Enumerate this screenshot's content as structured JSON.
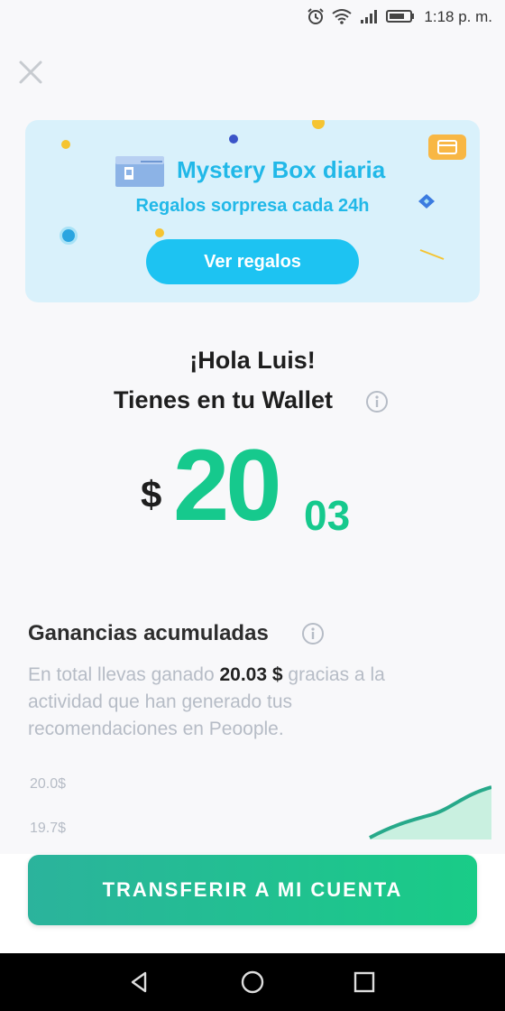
{
  "status_bar": {
    "time": "1:18 p. m.",
    "icons": [
      "alarm-icon",
      "wifi-icon",
      "signal-icon",
      "battery-icon"
    ]
  },
  "banner": {
    "title": "Mystery Box diaria",
    "subtitle": "Regalos sorpresa cada 24h",
    "button_label": "Ver regalos"
  },
  "wallet": {
    "greeting": "¡Hola Luis!",
    "label": "Tienes en tu Wallet",
    "currency": "$",
    "amount_integer": "20",
    "amount_decimal": "03"
  },
  "earnings": {
    "title": "Ganancias acumuladas",
    "text_before": "En total llevas ganado ",
    "amount": "20.03 $",
    "text_after": " gracias a la actividad que han generado tus recomendaciones en Peoople."
  },
  "chart_labels": [
    "20.0$",
    "19.7$"
  ],
  "actions": {
    "transfer_label": "TRANSFERIR A MI CUENTA"
  },
  "nav": [
    "back-icon",
    "home-icon",
    "recents-icon"
  ],
  "colors": {
    "accent_green": "#16c98d",
    "banner_blue": "#21b8e8",
    "banner_bg": "#d9f1fb"
  }
}
